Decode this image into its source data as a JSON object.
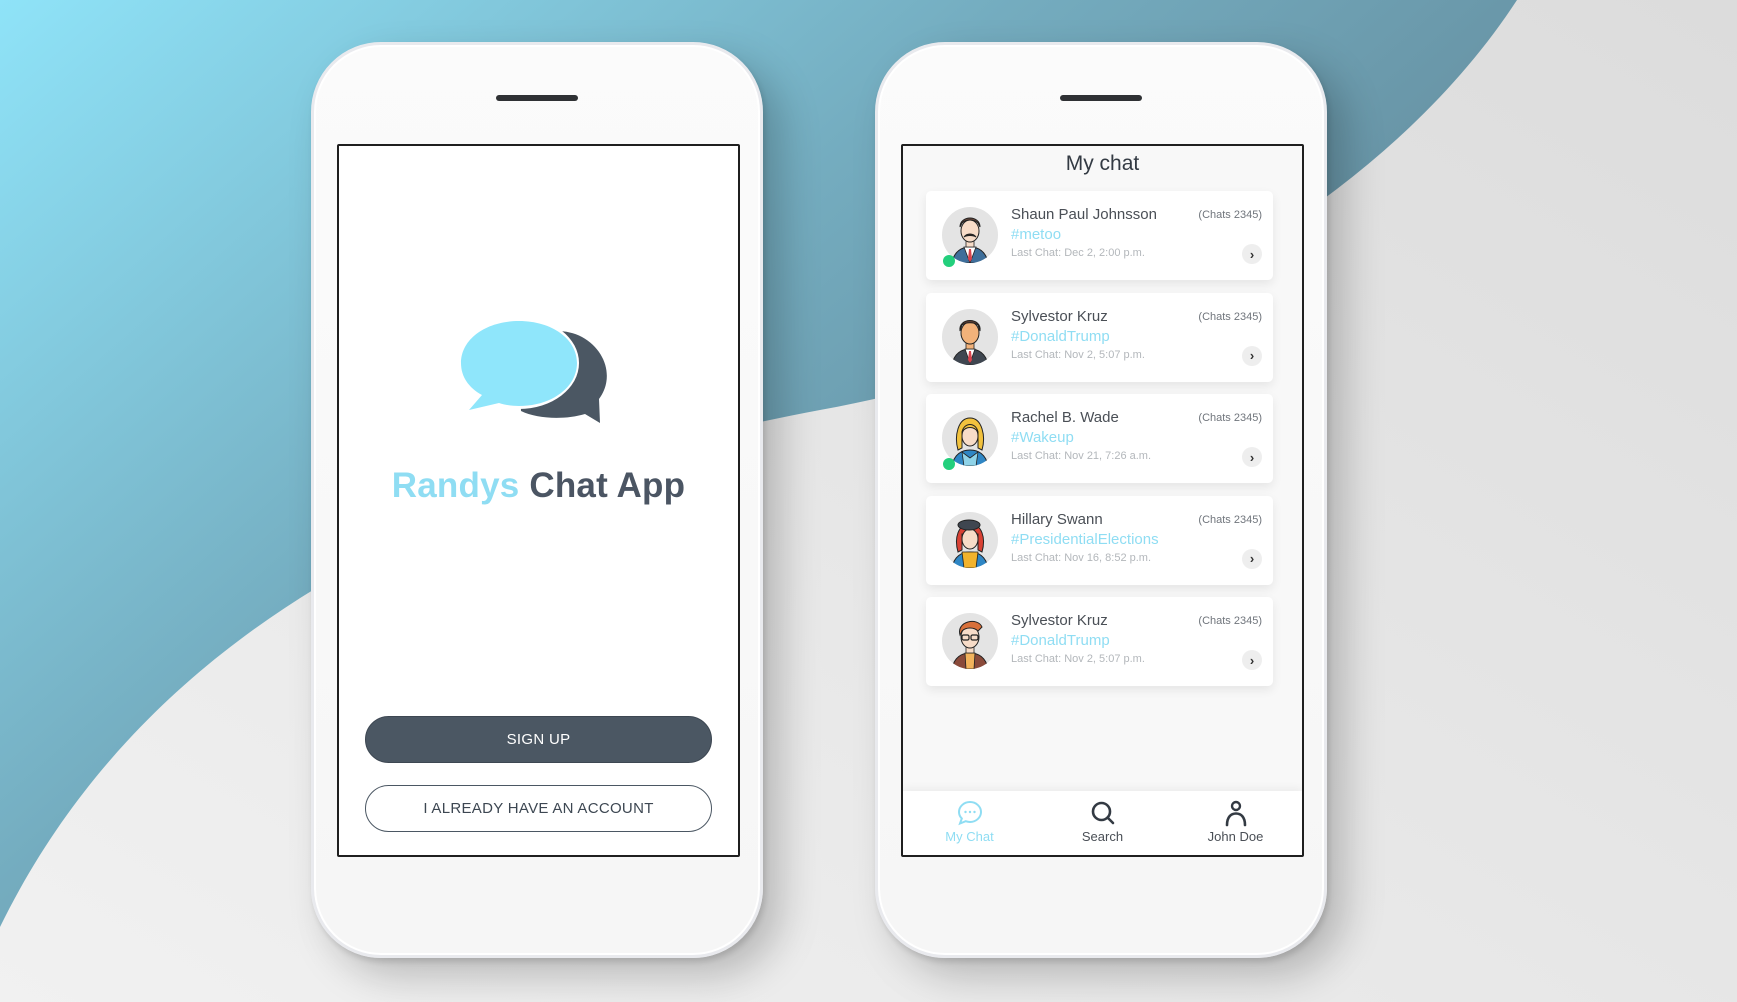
{
  "colors": {
    "accent": "#8fddf3",
    "dark": "#4b5763",
    "online": "#23cf7c",
    "bg_blue_light": "#8fe1f7",
    "bg_blue_dark": "#5e7f8f",
    "bg_gray": "#e6e6e6"
  },
  "welcome": {
    "title_part1": "Randys",
    "title_part2": "Chat App",
    "logo_icon": "chat-bubbles-icon",
    "signup_label": "SIGN UP",
    "login_label": "I ALREADY HAVE AN ACCOUNT"
  },
  "chats": {
    "title": "My chat",
    "items": [
      {
        "name": "Shaun Paul Johnsson",
        "tag": "#metoo",
        "last": "Last Chat: Dec 2, 2:00 p.m.",
        "count": "(Chats 2345)",
        "online": true,
        "avatar": "man-mustache-avatar"
      },
      {
        "name": "Sylvestor Kruz",
        "tag": "#DonaldTrump",
        "last": "Last Chat: Nov 2, 5:07 p.m.",
        "count": "(Chats 2345)",
        "online": false,
        "avatar": "man-suit-avatar"
      },
      {
        "name": "Rachel B. Wade",
        "tag": "#Wakeup",
        "last": "Last Chat: Nov 21, 7:26 a.m.",
        "count": "(Chats 2345)",
        "online": true,
        "avatar": "woman-blonde-avatar"
      },
      {
        "name": "Hillary Swann",
        "tag": "#PresidentialElections",
        "last": "Last Chat: Nov 16, 8:52 p.m.",
        "count": "(Chats 2345)",
        "online": false,
        "avatar": "woman-beret-avatar"
      },
      {
        "name": "Sylvestor Kruz",
        "tag": "#DonaldTrump",
        "last": "Last Chat: Nov 2, 5:07 p.m.",
        "count": "(Chats 2345)",
        "online": false,
        "avatar": "man-glasses-avatar"
      }
    ],
    "arrow_icon": "chevron-right-icon"
  },
  "nav": {
    "items": [
      {
        "label": "My Chat",
        "icon": "chat-icon",
        "active": true
      },
      {
        "label": "Search",
        "icon": "search-icon",
        "active": false
      },
      {
        "label": "John Doe",
        "icon": "user-icon",
        "active": false
      }
    ]
  }
}
